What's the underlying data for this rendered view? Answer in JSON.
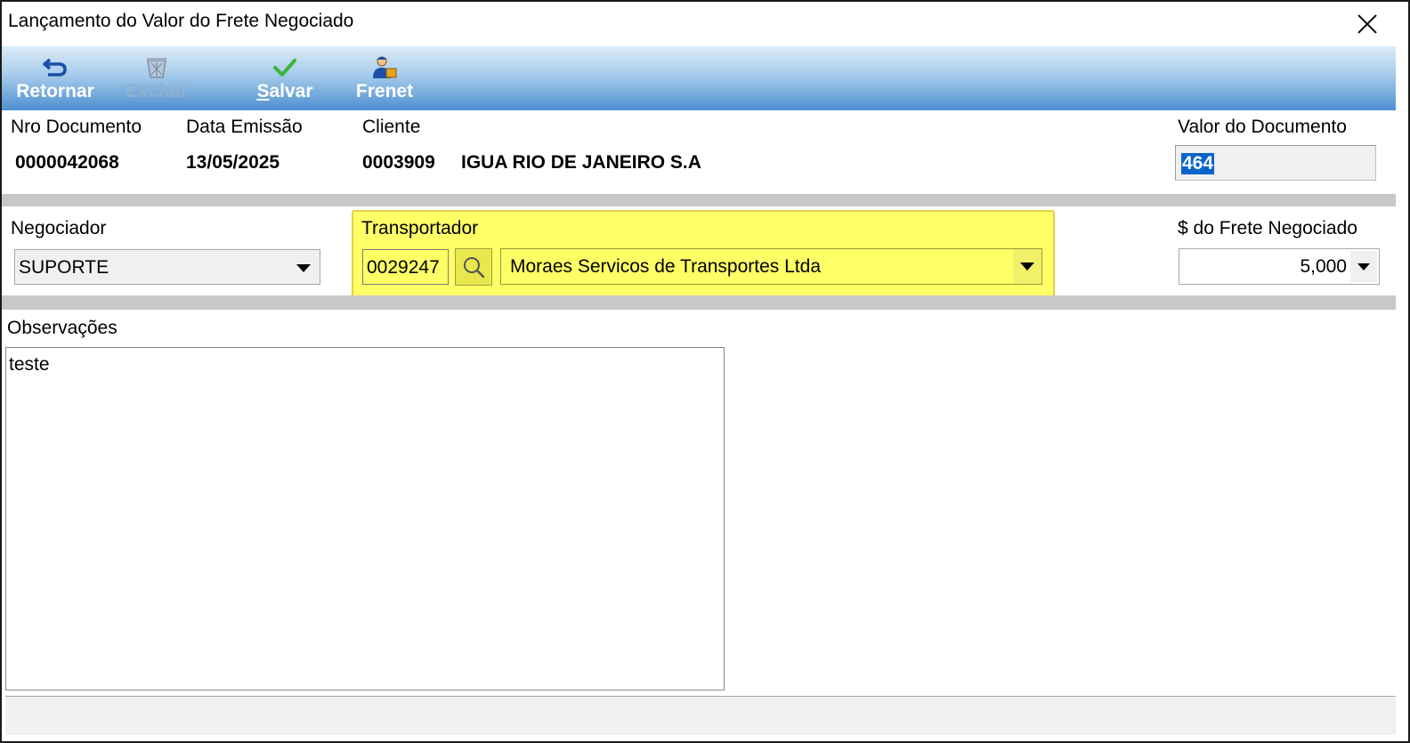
{
  "window": {
    "title": "Lançamento do Valor do Frete Negociado"
  },
  "toolbar": {
    "retornar": {
      "label": "Retornar",
      "icon": "return-arrow-icon"
    },
    "excluir": {
      "label": "Excluir",
      "icon": "trash-icon",
      "disabled": true
    },
    "salvar": {
      "label_first": "S",
      "label_rest": "alvar",
      "icon": "checkmark-icon"
    },
    "frenet": {
      "label": "Frenet",
      "icon": "delivery-person-icon"
    }
  },
  "header": {
    "nro_documento": {
      "label": "Nro Documento",
      "value": "0000042068"
    },
    "data_emissao": {
      "label": "Data Emissão",
      "value": "13/05/2025"
    },
    "cliente": {
      "label": "Cliente",
      "code": "0003909",
      "name": "IGUA RIO DE JANEIRO S.A"
    },
    "valor_documento": {
      "label": "Valor do Documento",
      "value": "464"
    }
  },
  "negociador": {
    "label": "Negociador",
    "value": "SUPORTE"
  },
  "transportador": {
    "label": "Transportador",
    "code": "0029247",
    "name": "Moraes Servicos de Transportes Ltda",
    "highlight_color": "#ffff66"
  },
  "frete": {
    "label": "$ do Frete Negociado",
    "value": "5,000"
  },
  "observacoes": {
    "label": "Observações",
    "value": "teste"
  },
  "colors": {
    "toolbar_top": "#dcecf8",
    "toolbar_bottom": "#4d8fd0",
    "selection": "#0a64cc",
    "band": "#c8c8c8"
  }
}
